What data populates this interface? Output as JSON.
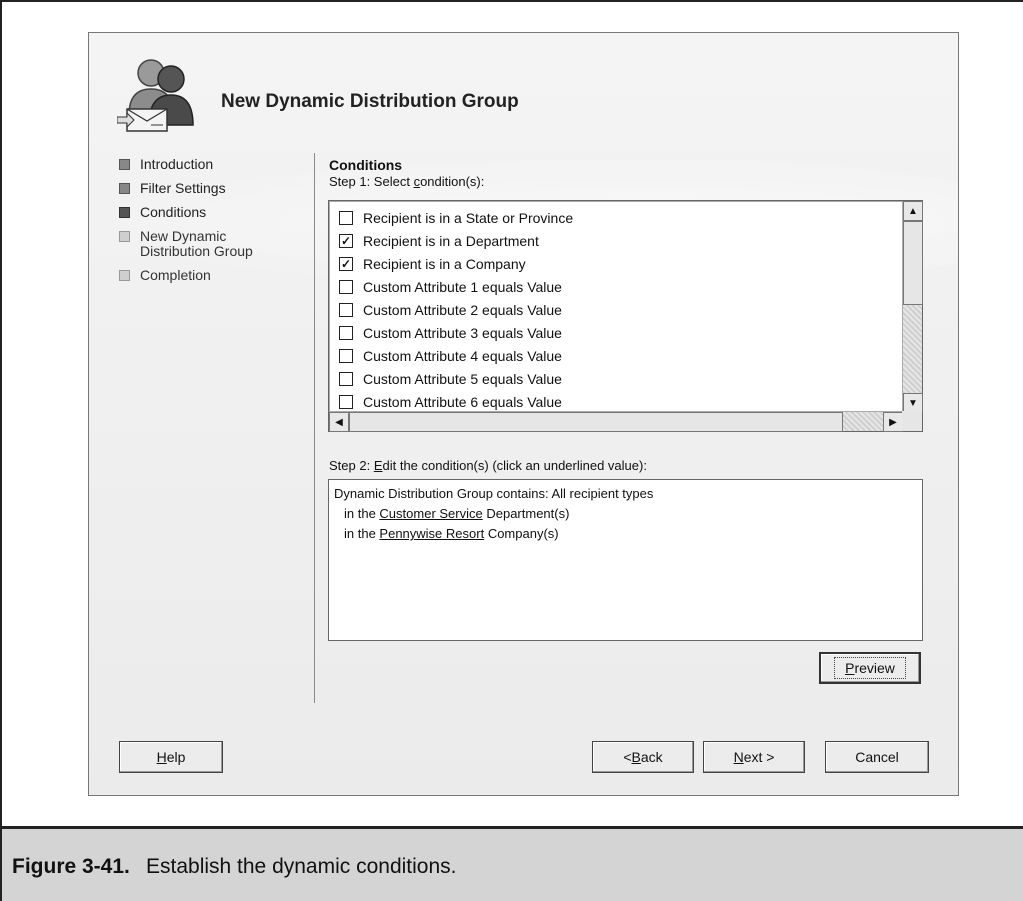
{
  "dialog": {
    "title": "New Dynamic Distribution Group"
  },
  "nav": {
    "items": [
      {
        "label": "Introduction",
        "state": "done"
      },
      {
        "label": "Filter Settings",
        "state": "done"
      },
      {
        "label": "Conditions",
        "state": "active"
      },
      {
        "label": "New Dynamic Distribution Group",
        "state": "pending"
      },
      {
        "label": "Completion",
        "state": "pending"
      }
    ]
  },
  "conditions": {
    "section_title": "Conditions",
    "step1_prefix": "Step 1: Select ",
    "step1_accel": "c",
    "step1_suffix": "ondition(s):",
    "items": [
      {
        "label": "Recipient is in a State or Province",
        "checked": false
      },
      {
        "label": "Recipient is in a Department",
        "checked": true
      },
      {
        "label": "Recipient is in a Company",
        "checked": true
      },
      {
        "label": "Custom Attribute 1 equals Value",
        "checked": false
      },
      {
        "label": "Custom Attribute 2 equals Value",
        "checked": false
      },
      {
        "label": "Custom Attribute 3 equals Value",
        "checked": false
      },
      {
        "label": "Custom Attribute 4 equals Value",
        "checked": false
      },
      {
        "label": "Custom Attribute 5 equals Value",
        "checked": false
      },
      {
        "label": "Custom Attribute 6 equals Value",
        "checked": false
      }
    ],
    "step2_prefix": "Step 2: ",
    "step2_accel": "E",
    "step2_suffix": "dit the condition(s) (click an underlined value):",
    "summary_line": "Dynamic Distribution Group contains: All recipient types",
    "dept_prefix": "in the ",
    "dept_value": "Customer Service",
    "dept_suffix": " Department(s)",
    "company_prefix": "in the ",
    "company_value": "Pennywise Resort",
    "company_suffix": " Company(s)"
  },
  "buttons": {
    "preview_accel": "P",
    "preview_rest": "review",
    "help_accel": "H",
    "help_rest": "elp",
    "back_pre": "< ",
    "back_accel": "B",
    "back_rest": "ack",
    "next_accel": "N",
    "next_rest": "ext >",
    "cancel": "Cancel"
  },
  "caption": {
    "figure_number": "Figure 3-41.",
    "text": "Establish the dynamic conditions."
  }
}
